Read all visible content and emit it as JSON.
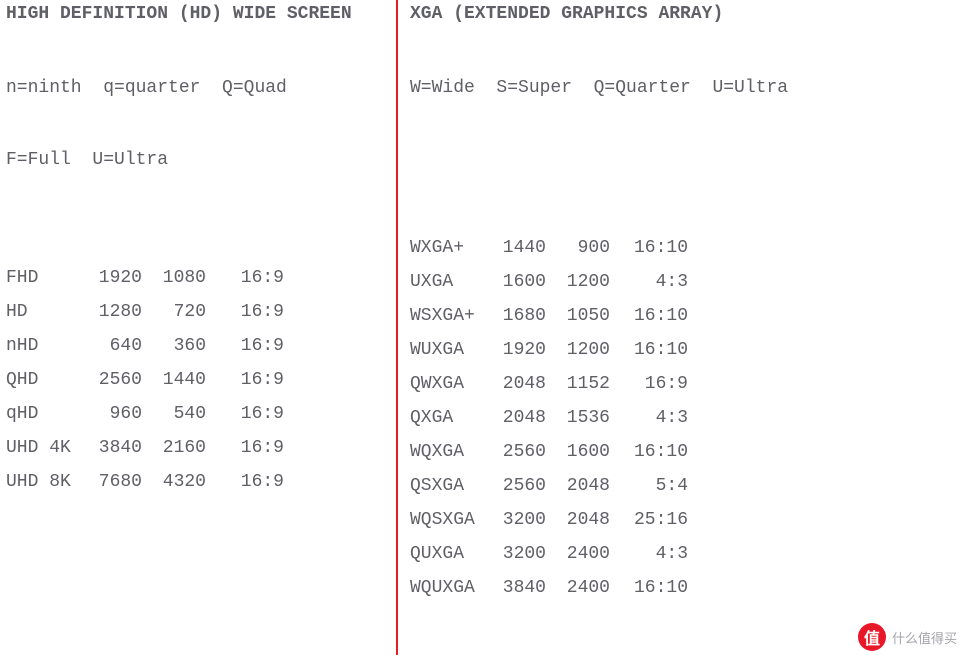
{
  "left": {
    "heading": "HIGH DEFINITION (HD) WIDE SCREEN",
    "legend": [
      "n=ninth  q=quarter  Q=Quad",
      "F=Full  U=Ultra"
    ],
    "rows": [
      {
        "name": "FHD",
        "w": "1920",
        "h": "1080",
        "ar": "16:9"
      },
      {
        "name": "HD",
        "w": "1280",
        "h": "720",
        "ar": "16:9"
      },
      {
        "name": "nHD",
        "w": "640",
        "h": "360",
        "ar": "16:9"
      },
      {
        "name": "QHD",
        "w": "2560",
        "h": "1440",
        "ar": "16:9"
      },
      {
        "name": "qHD",
        "w": "960",
        "h": "540",
        "ar": "16:9"
      },
      {
        "name": "UHD 4K",
        "w": "3840",
        "h": "2160",
        "ar": "16:9"
      },
      {
        "name": "UHD 8K",
        "w": "7680",
        "h": "4320",
        "ar": "16:9"
      }
    ]
  },
  "right": {
    "heading": "XGA (EXTENDED GRAPHICS ARRAY)",
    "legend": [
      "W=Wide  S=Super  Q=Quarter  U=Ultra"
    ],
    "rows": [
      {
        "name": "WXGA+",
        "w": "1440",
        "h": "900",
        "ar": "16:10"
      },
      {
        "name": "UXGA",
        "w": "1600",
        "h": "1200",
        "ar": "4:3"
      },
      {
        "name": "WSXGA+",
        "w": "1680",
        "h": "1050",
        "ar": "16:10"
      },
      {
        "name": "WUXGA",
        "w": "1920",
        "h": "1200",
        "ar": "16:10"
      },
      {
        "name": "QWXGA",
        "w": "2048",
        "h": "1152",
        "ar": "16:9"
      },
      {
        "name": "QXGA",
        "w": "2048",
        "h": "1536",
        "ar": "4:3"
      },
      {
        "name": "WQXGA",
        "w": "2560",
        "h": "1600",
        "ar": "16:10"
      },
      {
        "name": "QSXGA",
        "w": "2560",
        "h": "2048",
        "ar": "5:4"
      },
      {
        "name": "WQSXGA",
        "w": "3200",
        "h": "2048",
        "ar": "25:16"
      },
      {
        "name": "QUXGA",
        "w": "3200",
        "h": "2400",
        "ar": "4:3"
      },
      {
        "name": "WQUXGA",
        "w": "3840",
        "h": "2400",
        "ar": "16:10"
      }
    ]
  },
  "watermark": {
    "logo": "值",
    "text": "什么值得买"
  }
}
